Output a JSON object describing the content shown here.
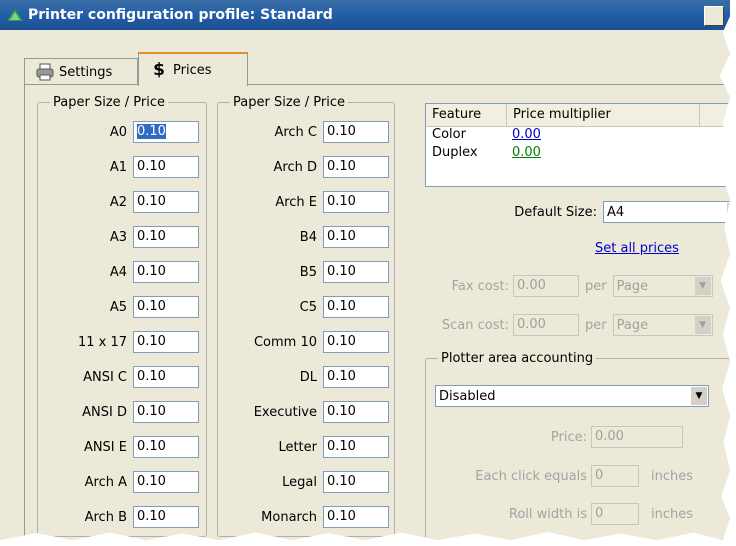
{
  "window": {
    "title": "Printer configuration profile: Standard"
  },
  "tabs": [
    {
      "label": "Settings",
      "icon": "printer-icon",
      "active": false
    },
    {
      "label": "Prices",
      "icon": "dollar-icon",
      "active": true
    }
  ],
  "paper_group_1": {
    "legend": "Paper Size / Price",
    "rows": [
      {
        "label": "A0",
        "value": "0.10"
      },
      {
        "label": "A1",
        "value": "0.10"
      },
      {
        "label": "A2",
        "value": "0.10"
      },
      {
        "label": "A3",
        "value": "0.10"
      },
      {
        "label": "A4",
        "value": "0.10"
      },
      {
        "label": "A5",
        "value": "0.10"
      },
      {
        "label": "11 x 17",
        "value": "0.10"
      },
      {
        "label": "ANSI C",
        "value": "0.10"
      },
      {
        "label": "ANSI D",
        "value": "0.10"
      },
      {
        "label": "ANSI E",
        "value": "0.10"
      },
      {
        "label": "Arch A",
        "value": "0.10"
      },
      {
        "label": "Arch B",
        "value": "0.10"
      }
    ]
  },
  "paper_group_2": {
    "legend": "Paper Size / Price",
    "rows": [
      {
        "label": "Arch C",
        "value": "0.10"
      },
      {
        "label": "Arch D",
        "value": "0.10"
      },
      {
        "label": "Arch E",
        "value": "0.10"
      },
      {
        "label": "B4",
        "value": "0.10"
      },
      {
        "label": "B5",
        "value": "0.10"
      },
      {
        "label": "C5",
        "value": "0.10"
      },
      {
        "label": "Comm 10",
        "value": "0.10"
      },
      {
        "label": "DL",
        "value": "0.10"
      },
      {
        "label": "Executive",
        "value": "0.10"
      },
      {
        "label": "Letter",
        "value": "0.10"
      },
      {
        "label": "Legal",
        "value": "0.10"
      },
      {
        "label": "Monarch",
        "value": "0.10"
      }
    ]
  },
  "features": {
    "headers": [
      "Feature",
      "Price multiplier"
    ],
    "rows": [
      {
        "feature": "Color",
        "multiplier": "0.00",
        "color": "#0000cc"
      },
      {
        "feature": "Duplex",
        "multiplier": "0.00",
        "color": "#008000"
      }
    ]
  },
  "default_size": {
    "label": "Default Size:",
    "value": "A4"
  },
  "set_all_prices": "Set all prices",
  "fax": {
    "label": "Fax cost:",
    "value": "0.00",
    "per": "per",
    "unit": "Page"
  },
  "scan": {
    "label": "Scan cost:",
    "value": "0.00",
    "per": "per",
    "unit": "Page"
  },
  "plotter": {
    "legend": "Plotter area accounting",
    "mode": "Disabled",
    "price_label": "Price:",
    "price_value": "0.00",
    "click_label": "Each click equals",
    "click_value": "0",
    "click_unit": "inches",
    "roll_label": "Roll width is",
    "roll_value": "0",
    "roll_unit": "inches"
  }
}
